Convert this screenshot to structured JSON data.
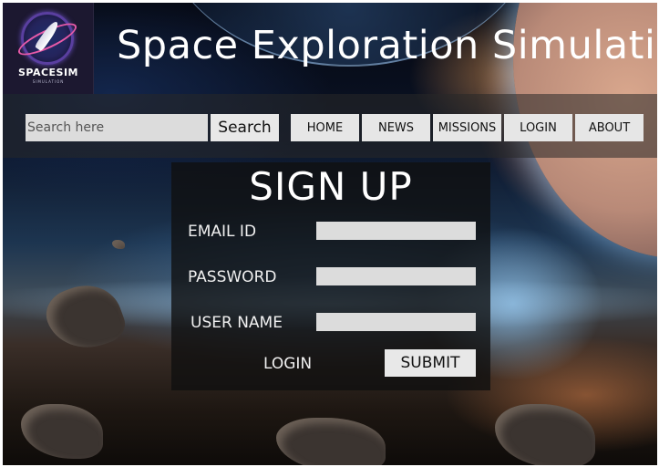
{
  "logo": {
    "name": "SPACESIM",
    "tagline": "SIMULATION"
  },
  "header": {
    "title": "Space Exploration Simulation"
  },
  "search": {
    "placeholder": "Search here",
    "value": "",
    "button_label": "Search"
  },
  "nav": {
    "items": [
      {
        "label": "HOME"
      },
      {
        "label": "NEWS"
      },
      {
        "label": "MISSIONS"
      },
      {
        "label": "LOGIN"
      },
      {
        "label": "ABOUT"
      }
    ]
  },
  "signup": {
    "title": "SIGN UP",
    "fields": [
      {
        "label": "EMAIL ID",
        "value": ""
      },
      {
        "label": "PASSWORD",
        "value": ""
      },
      {
        "label": "USER NAME",
        "value": ""
      }
    ],
    "login_label": "LOGIN",
    "submit_label": "SUBMIT"
  },
  "colors": {
    "nav_button_bg": "#e6e6e6",
    "input_bg": "#dcdcdc",
    "panel_bg": "#0f0f0f",
    "title_text": "#ffffff"
  }
}
